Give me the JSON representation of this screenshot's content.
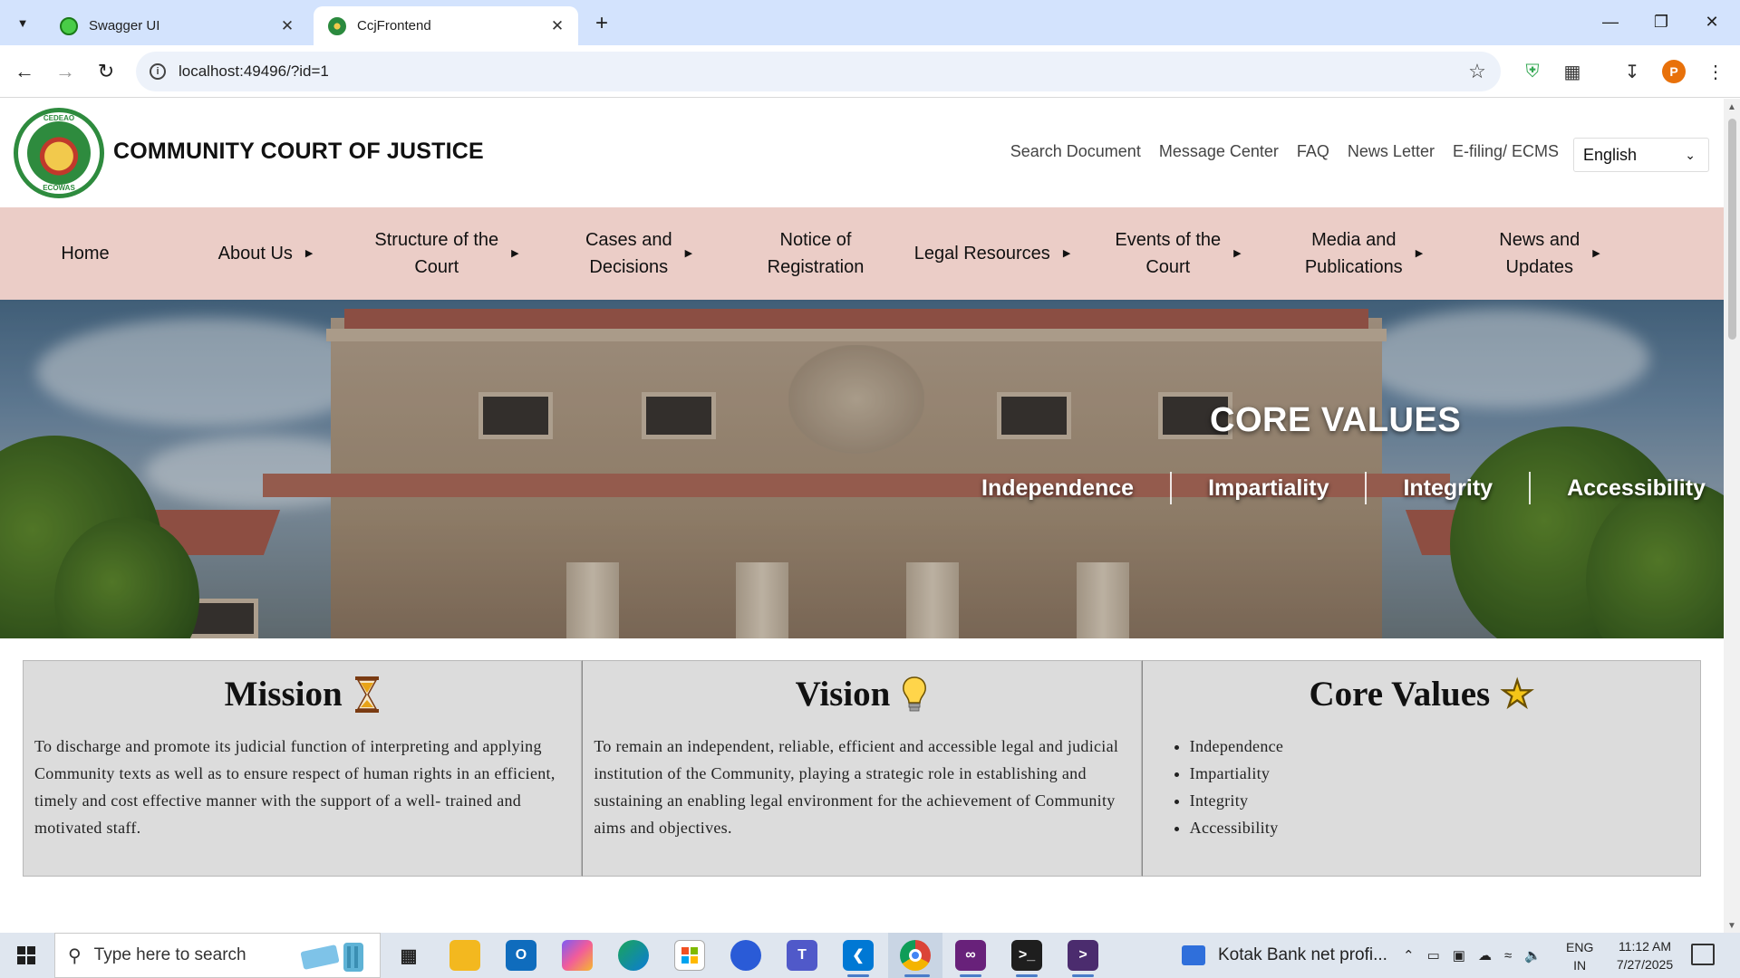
{
  "browser": {
    "tabs": [
      {
        "title": "Swagger UI",
        "active": false
      },
      {
        "title": "CcjFrontend",
        "active": true
      }
    ],
    "url": "localhost:49496/?id=1",
    "profile_initial": "P"
  },
  "site": {
    "title": "COMMUNITY COURT OF JUSTICE",
    "logo_text_top": "CEDEAO",
    "logo_text_bottom": "ECOWAS",
    "top_links": [
      "Search Document",
      "Message Center",
      "FAQ",
      "News Letter",
      "E-filing/ ECMS"
    ],
    "language": "English",
    "nav": [
      {
        "label": "Home",
        "has_submenu": false
      },
      {
        "label": "About Us",
        "has_submenu": true
      },
      {
        "label": "Structure of the\nCourt",
        "has_submenu": true
      },
      {
        "label": "Cases and\nDecisions",
        "has_submenu": true
      },
      {
        "label": "Notice of\nRegistration",
        "has_submenu": false
      },
      {
        "label": "Legal Resources",
        "has_submenu": true
      },
      {
        "label": "Events of the\nCourt",
        "has_submenu": true
      },
      {
        "label": "Media and\nPublications",
        "has_submenu": true
      },
      {
        "label": "News and\nUpdates",
        "has_submenu": true
      }
    ]
  },
  "hero": {
    "title": "CORE VALUES",
    "values": [
      "Independence",
      "Impartiality",
      "Integrity",
      "Accessibility"
    ]
  },
  "cards": {
    "mission": {
      "title": "Mission",
      "icon": "hourglass-icon",
      "text": "To discharge and promote its judicial function of interpreting and applying Community texts as well as to ensure respect of human rights in an efficient, timely and cost effective manner with the support of a well- trained and motivated staff."
    },
    "vision": {
      "title": "Vision",
      "icon": "lightbulb-icon",
      "text": "To remain an independent, reliable, efficient and accessible legal and judicial institution of the Community, playing a strategic role in establishing and sustaining an enabling legal environment for the achievement of Community aims and objectives."
    },
    "core_values": {
      "title": "Core Values",
      "icon": "star-icon",
      "items": [
        "Independence",
        "Impartiality",
        "Integrity",
        "Accessibility"
      ]
    }
  },
  "taskbar": {
    "search_placeholder": "Type here to search",
    "news_text": "Kotak Bank net profi...",
    "lang_line1": "ENG",
    "lang_line2": "IN",
    "time": "11:12 AM",
    "date": "7/27/2025"
  }
}
